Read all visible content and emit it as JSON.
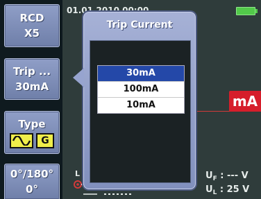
{
  "sidebar": {
    "rcd": {
      "line1": "RCD",
      "line2": "X5"
    },
    "trip": {
      "line1": "Trip ...",
      "line2": "30mA"
    },
    "type": {
      "line1": "Type",
      "icon_g": "G"
    },
    "angle": {
      "line1": "0°/180°",
      "line2": "0°"
    }
  },
  "status": {
    "datetime": "01.01.2010   00:00",
    "battery_color": "#52c94a"
  },
  "popup": {
    "title": "Trip Current",
    "options": [
      "30mA",
      "100mA",
      "10mA"
    ],
    "selected": "30mA"
  },
  "display": {
    "unit_badge": "mA",
    "badge_color": "#d61e2b",
    "uf_label": "U",
    "uf_sub": "F",
    "uf_value": ": --- V",
    "ul_label": "U",
    "ul_sub": "L",
    "ul_value": ": 25 V",
    "circuit_label": "L"
  }
}
